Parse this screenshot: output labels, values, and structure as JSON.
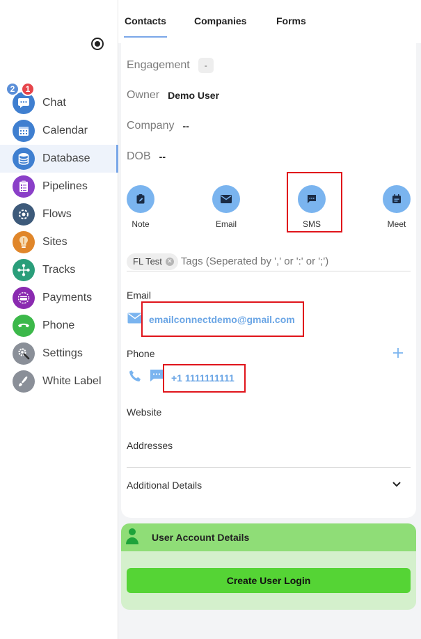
{
  "tabs": [
    {
      "label": "Contacts",
      "active": true
    },
    {
      "label": "Companies",
      "active": false
    },
    {
      "label": "Forms",
      "active": false
    }
  ],
  "sidebar": {
    "items": [
      {
        "label": "Chat",
        "icon": "chat-icon",
        "color": "#3f7fd0",
        "badges": [
          "2",
          "1"
        ]
      },
      {
        "label": "Calendar",
        "icon": "calendar-icon",
        "color": "#3f7fd0"
      },
      {
        "label": "Database",
        "icon": "database-icon",
        "color": "#3f7fd0",
        "active": true
      },
      {
        "label": "Pipelines",
        "icon": "pipelines-icon",
        "color": "#8a3fc8"
      },
      {
        "label": "Flows",
        "icon": "flows-icon",
        "color": "#3d5a7a"
      },
      {
        "label": "Sites",
        "icon": "sites-icon",
        "color": "#e0862a"
      },
      {
        "label": "Tracks",
        "icon": "tracks-icon",
        "color": "#2a9e7a"
      },
      {
        "label": "Payments",
        "icon": "payments-icon",
        "color": "#8a2ab0"
      },
      {
        "label": "Phone",
        "icon": "phone-icon",
        "color": "#3cb84a"
      },
      {
        "label": "Settings",
        "icon": "settings-icon",
        "color": "#8a8f98"
      },
      {
        "label": "White Label",
        "icon": "white-label-icon",
        "color": "#8a8f98"
      }
    ]
  },
  "contact": {
    "engagement_label": "Engagement",
    "engagement_value": "-",
    "owner_label": "Owner",
    "owner_value": "Demo User",
    "company_label": "Company",
    "company_value": "--",
    "dob_label": "DOB",
    "dob_value": "--"
  },
  "actions": [
    {
      "label": "Note",
      "icon": "note-icon"
    },
    {
      "label": "Email",
      "icon": "email-icon"
    },
    {
      "label": "SMS",
      "icon": "sms-icon",
      "highlighted": true
    },
    {
      "label": "Meet",
      "icon": "meet-icon"
    }
  ],
  "tags": {
    "items": [
      "FL Test"
    ],
    "placeholder": "Tags (Seperated by ',' or ':' or ';')"
  },
  "email": {
    "label": "Email",
    "value": "emailconnectdemo@gmail.com"
  },
  "phone": {
    "label": "Phone",
    "value": "+1 1111111111"
  },
  "website_label": "Website",
  "addresses_label": "Addresses",
  "additional_details_label": "Additional Details",
  "user_account": {
    "title": "User Account Details",
    "button_label": "Create User Login"
  },
  "colors": {
    "accent": "#7ab4ef",
    "link": "#6aa5e5",
    "highlight_box": "#e0141b",
    "user_header": "#8fdd77",
    "user_button": "#55d435"
  }
}
